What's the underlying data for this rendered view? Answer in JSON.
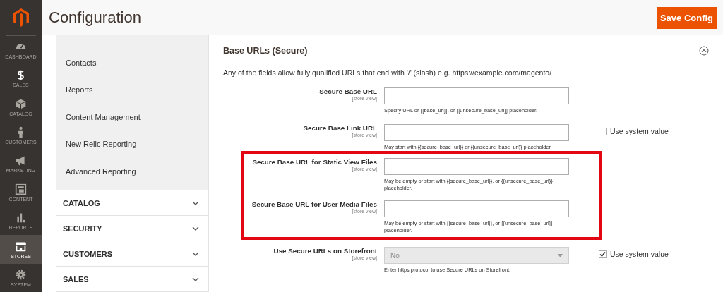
{
  "nav": [
    {
      "label": "DASHBOARD",
      "selected": false
    },
    {
      "label": "SALES",
      "selected": false
    },
    {
      "label": "CATALOG",
      "selected": false
    },
    {
      "label": "CUSTOMERS",
      "selected": false
    },
    {
      "label": "MARKETING",
      "selected": false
    },
    {
      "label": "CONTENT",
      "selected": false
    },
    {
      "label": "REPORTS",
      "selected": false
    },
    {
      "label": "STORES",
      "selected": true
    },
    {
      "label": "SYSTEM",
      "selected": false
    }
  ],
  "header": {
    "title": "Configuration",
    "save_button": "Save Config"
  },
  "sidebar": {
    "items": [
      "Contacts",
      "Reports",
      "Content Management",
      "New Relic Reporting",
      "Advanced Reporting"
    ],
    "groups": [
      {
        "label": "CATALOG",
        "expanded": false
      },
      {
        "label": "SECURITY",
        "expanded": false
      },
      {
        "label": "CUSTOMERS",
        "expanded": false
      },
      {
        "label": "SALES",
        "expanded": false
      }
    ]
  },
  "section": {
    "title": "Base URLs (Secure)",
    "expanded": true,
    "description": "Any of the fields allow fully qualified URLs that end with '/' (slash) e.g. https://example.com/magento/",
    "rows": [
      {
        "kind": "text",
        "label": "Secure Base URL",
        "scope": "[store view]",
        "note": "Specify URL or {{base_url}}, or {{unsecure_base_url}} placeholder.",
        "highlighted": false
      },
      {
        "kind": "text",
        "label": "Secure Base Link URL",
        "scope": "[store view]",
        "note": "May start with {{secure_base_url}} or {{unsecure_base_url}} placeholder.",
        "highlighted": false,
        "system_value": {
          "label": "Use system value",
          "checked": false
        }
      },
      {
        "kind": "text",
        "label": "Secure Base URL for Static View Files",
        "scope": "[store view]",
        "note": "May be empty or start with {{secure_base_url}}, or {{unsecure_base_url}} placeholder.",
        "highlighted": true
      },
      {
        "kind": "text",
        "label": "Secure Base URL for User Media Files",
        "scope": "[store view]",
        "note": "May be empty or start with {{secure_base_url}}, or {{unsecure_base_url}} placeholder.",
        "highlighted": true
      },
      {
        "kind": "select",
        "label": "Use Secure URLs on Storefront",
        "scope": "[store view]",
        "value": "No",
        "disabled": true,
        "note": "Enter https protocol to use Secure URLs on Storefront.",
        "highlighted": false,
        "system_value": {
          "label": "Use system value",
          "checked": true
        }
      }
    ]
  }
}
